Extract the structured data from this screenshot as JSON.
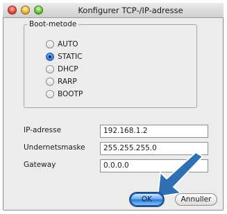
{
  "window": {
    "title": "Konfigurer TCP-/IP-adresse"
  },
  "boot_method": {
    "legend": "Boot-metode",
    "options": [
      {
        "label": "AUTO",
        "selected": false
      },
      {
        "label": "STATIC",
        "selected": true
      },
      {
        "label": "DHCP",
        "selected": false
      },
      {
        "label": "RARP",
        "selected": false
      },
      {
        "label": "BOOTP",
        "selected": false
      }
    ]
  },
  "fields": {
    "ip": {
      "label": "IP-adresse",
      "value": "192.168.1.2"
    },
    "subnet": {
      "label": "Undernetsmaske",
      "value": "255.255.255.0"
    },
    "gateway": {
      "label": "Gateway",
      "value": "0.0.0.0"
    }
  },
  "buttons": {
    "ok": "OK",
    "cancel": "Annuller"
  },
  "colors": {
    "accent": "#2a76d2",
    "arrow": "#2f6fb3"
  },
  "icons": {
    "pointer": "arrow-icon"
  }
}
